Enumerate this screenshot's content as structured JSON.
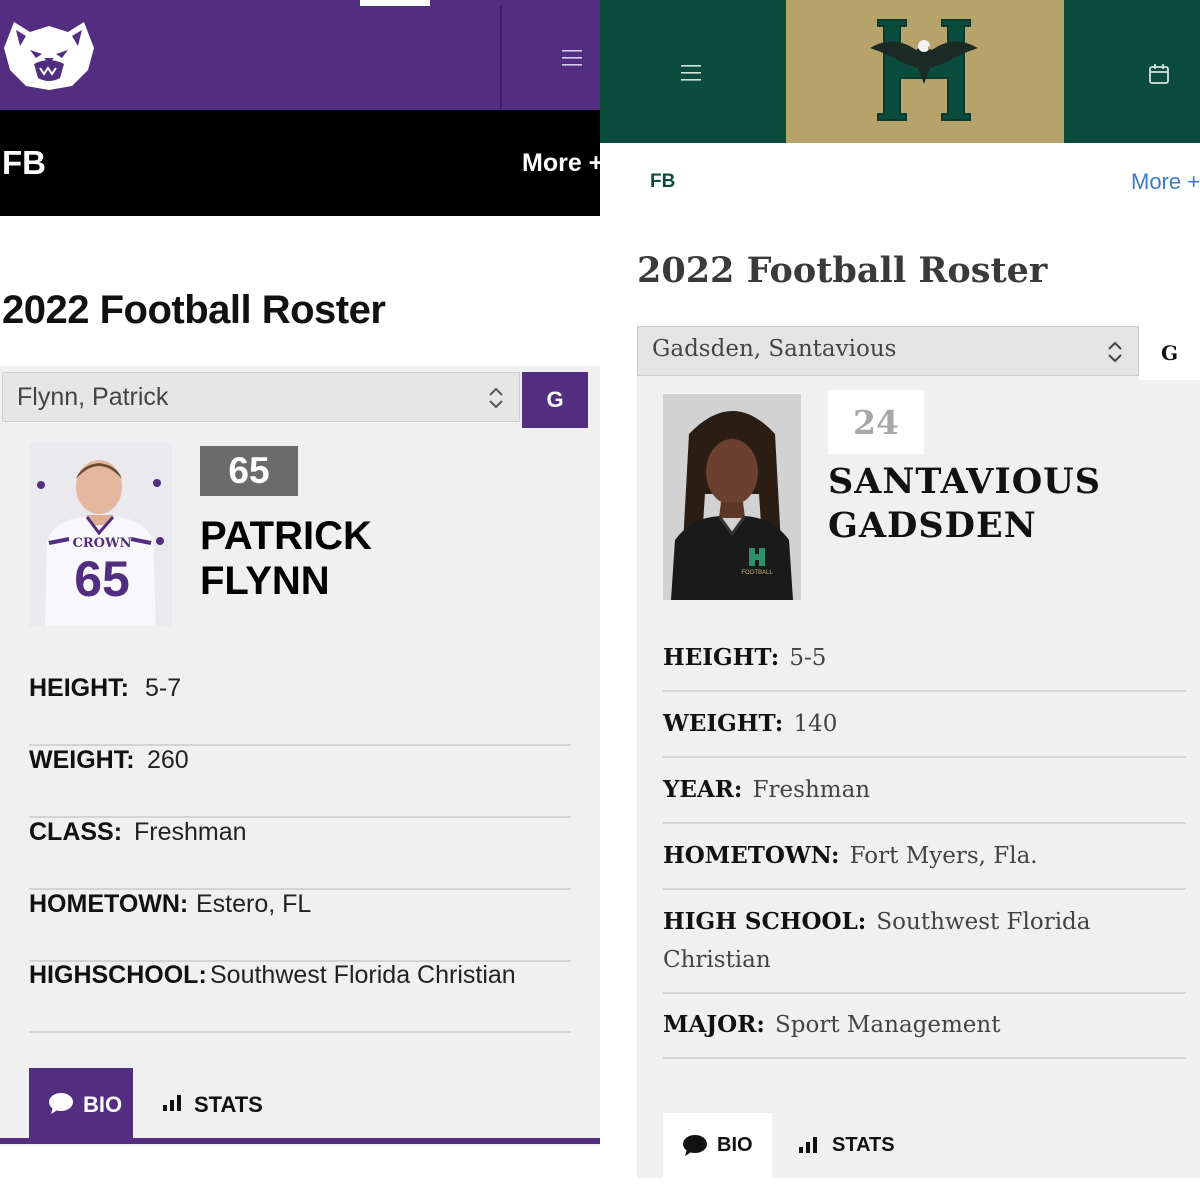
{
  "left": {
    "header": {
      "logo_icon": "bear-logo-icon",
      "menu_icon": "hamburger-menu-icon",
      "brand_color": "#522d80"
    },
    "subnav": {
      "section": "FB",
      "more": "More +"
    },
    "page_title": "2022 Football Roster",
    "player_select": {
      "value": "Flynn, Patrick",
      "arrows_icon": "select-arrows-icon"
    },
    "position_button": "G",
    "player": {
      "number": "65",
      "first_name": "PATRICK",
      "last_name": "FLYNN",
      "jersey_text": "CROWN",
      "jersey_number": "65"
    },
    "details": [
      {
        "label": "HEIGHT:",
        "value": "5-7"
      },
      {
        "label": "WEIGHT:",
        "value": "260"
      },
      {
        "label": "CLASS:",
        "value": "Freshman"
      },
      {
        "label": "HOMETOWN:",
        "value": "Estero, FL"
      },
      {
        "label": "HIGHSCHOOL:",
        "value": "Southwest Florida Christian"
      }
    ],
    "tabs": {
      "bio": "BIO",
      "stats": "STATS"
    }
  },
  "right": {
    "header": {
      "logo_icon": "eagle-h-logo-icon",
      "menu_icon": "hamburger-menu-icon",
      "calendar_icon": "calendar-icon",
      "brand_color": "#0b4c3c",
      "accent_color": "#b5a36a"
    },
    "subnav": {
      "section": "FB",
      "more": "More +"
    },
    "page_title": "2022 Football Roster",
    "player_select": {
      "value": "Gadsden, Santavious",
      "arrows_icon": "select-arrows-icon"
    },
    "position_button": "G",
    "player": {
      "number": "24",
      "first_name": "SANTAVIOUS",
      "last_name": "GADSDEN",
      "shirt_text": "FOOTBALL"
    },
    "details": [
      {
        "label": "HEIGHT:",
        "value": "5-5"
      },
      {
        "label": "WEIGHT:",
        "value": "140"
      },
      {
        "label": "YEAR:",
        "value": "Freshman"
      },
      {
        "label": "HOMETOWN:",
        "value": "Fort Myers, Fla."
      },
      {
        "label": "HIGH SCHOOL:",
        "value": "Southwest Florida Christian"
      },
      {
        "label": "MAJOR:",
        "value": "Sport Management"
      }
    ],
    "tabs": {
      "bio": "BIO",
      "stats": "STATS"
    }
  }
}
